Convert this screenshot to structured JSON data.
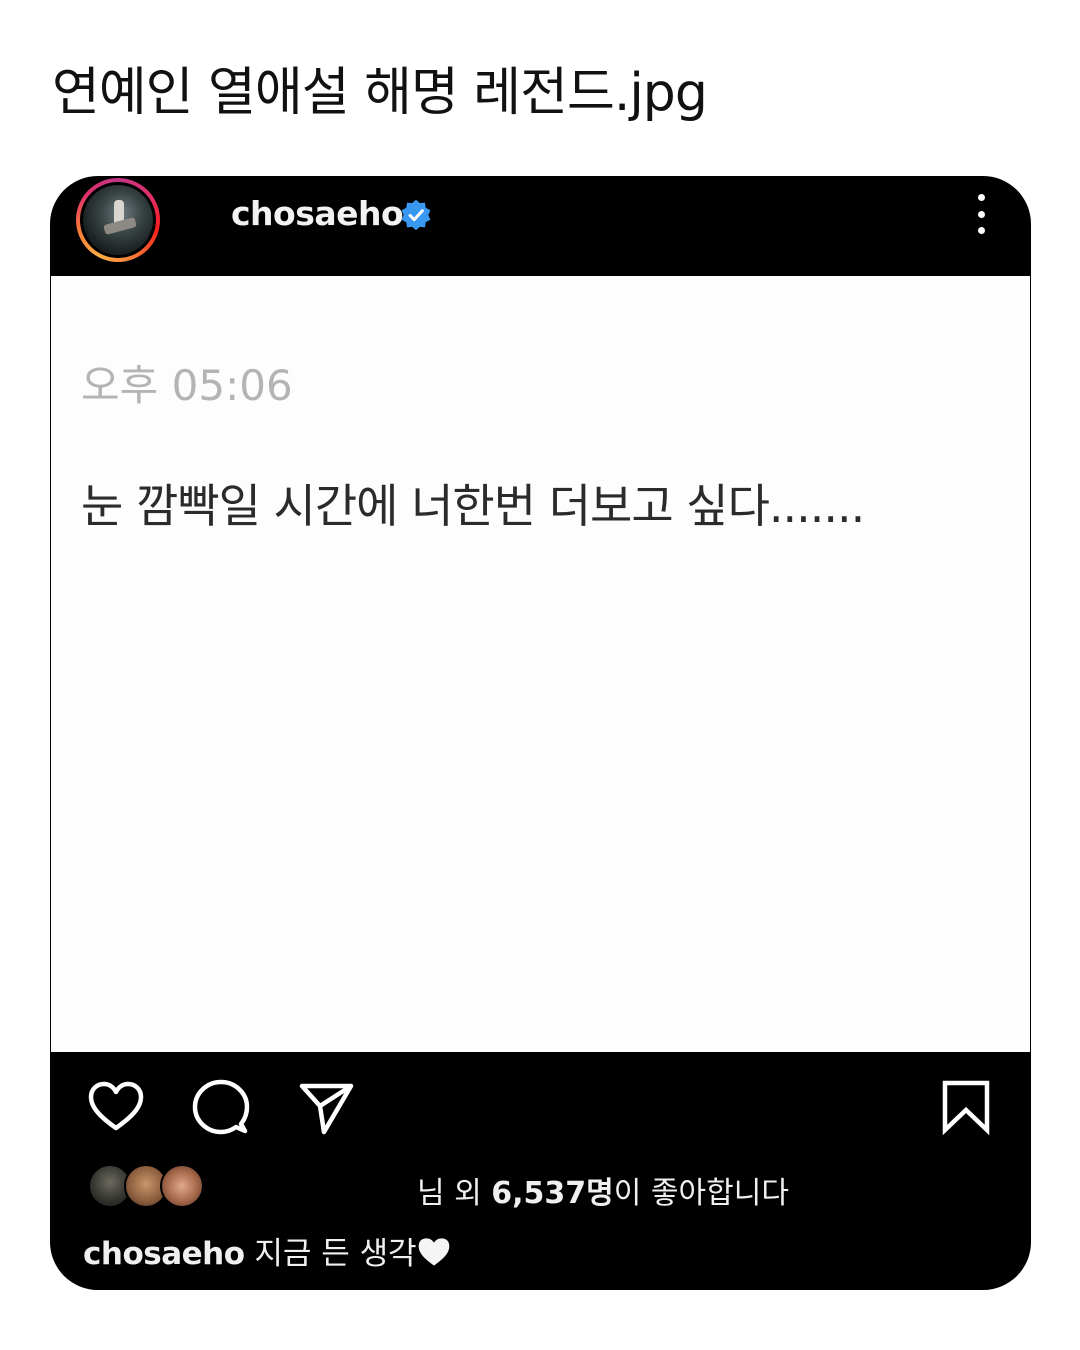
{
  "page": {
    "title": "연예인 열애설 해명 레전드.jpg"
  },
  "post": {
    "username": "chosaeho",
    "verified_icon": "verified-badge-icon",
    "menu_icon": "more-options-icon",
    "image": {
      "time": "오후 05:06",
      "text": "눈 깜빡일 시간에 너한번 더보고 싶다......."
    },
    "actions": {
      "like_icon": "heart-icon",
      "comment_icon": "comment-icon",
      "share_icon": "send-icon",
      "save_icon": "bookmark-icon"
    },
    "likes": {
      "prefix": "님 외 ",
      "count": "6,537명",
      "suffix": "이 좋아합니다"
    },
    "caption": {
      "username": "chosaeho",
      "text": " 지금 든 생각",
      "emoji_icon": "white-heart-icon"
    }
  },
  "colors": {
    "card_bg": "#000000",
    "verified": "#3897f0",
    "post_bg": "#fdfdfd"
  }
}
